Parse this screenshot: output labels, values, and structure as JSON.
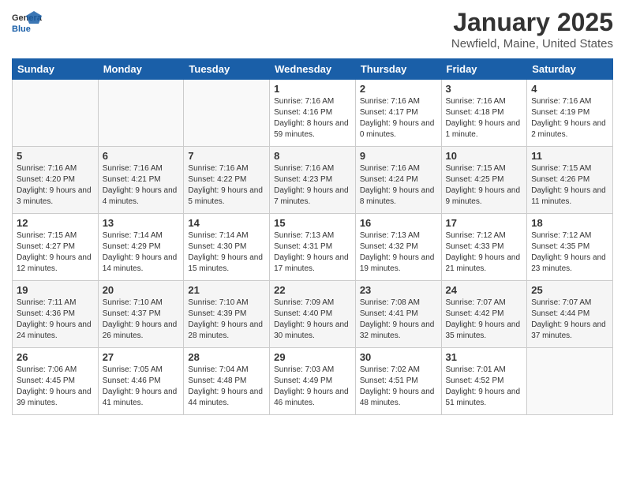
{
  "header": {
    "logo_general": "General",
    "logo_blue": "Blue",
    "month_title": "January 2025",
    "location": "Newfield, Maine, United States"
  },
  "days_of_week": [
    "Sunday",
    "Monday",
    "Tuesday",
    "Wednesday",
    "Thursday",
    "Friday",
    "Saturday"
  ],
  "weeks": [
    [
      {
        "day": "",
        "sunrise": "",
        "sunset": "",
        "daylight": ""
      },
      {
        "day": "",
        "sunrise": "",
        "sunset": "",
        "daylight": ""
      },
      {
        "day": "",
        "sunrise": "",
        "sunset": "",
        "daylight": ""
      },
      {
        "day": "1",
        "sunrise": "Sunrise: 7:16 AM",
        "sunset": "Sunset: 4:16 PM",
        "daylight": "Daylight: 8 hours and 59 minutes."
      },
      {
        "day": "2",
        "sunrise": "Sunrise: 7:16 AM",
        "sunset": "Sunset: 4:17 PM",
        "daylight": "Daylight: 9 hours and 0 minutes."
      },
      {
        "day": "3",
        "sunrise": "Sunrise: 7:16 AM",
        "sunset": "Sunset: 4:18 PM",
        "daylight": "Daylight: 9 hours and 1 minute."
      },
      {
        "day": "4",
        "sunrise": "Sunrise: 7:16 AM",
        "sunset": "Sunset: 4:19 PM",
        "daylight": "Daylight: 9 hours and 2 minutes."
      }
    ],
    [
      {
        "day": "5",
        "sunrise": "Sunrise: 7:16 AM",
        "sunset": "Sunset: 4:20 PM",
        "daylight": "Daylight: 9 hours and 3 minutes."
      },
      {
        "day": "6",
        "sunrise": "Sunrise: 7:16 AM",
        "sunset": "Sunset: 4:21 PM",
        "daylight": "Daylight: 9 hours and 4 minutes."
      },
      {
        "day": "7",
        "sunrise": "Sunrise: 7:16 AM",
        "sunset": "Sunset: 4:22 PM",
        "daylight": "Daylight: 9 hours and 5 minutes."
      },
      {
        "day": "8",
        "sunrise": "Sunrise: 7:16 AM",
        "sunset": "Sunset: 4:23 PM",
        "daylight": "Daylight: 9 hours and 7 minutes."
      },
      {
        "day": "9",
        "sunrise": "Sunrise: 7:16 AM",
        "sunset": "Sunset: 4:24 PM",
        "daylight": "Daylight: 9 hours and 8 minutes."
      },
      {
        "day": "10",
        "sunrise": "Sunrise: 7:15 AM",
        "sunset": "Sunset: 4:25 PM",
        "daylight": "Daylight: 9 hours and 9 minutes."
      },
      {
        "day": "11",
        "sunrise": "Sunrise: 7:15 AM",
        "sunset": "Sunset: 4:26 PM",
        "daylight": "Daylight: 9 hours and 11 minutes."
      }
    ],
    [
      {
        "day": "12",
        "sunrise": "Sunrise: 7:15 AM",
        "sunset": "Sunset: 4:27 PM",
        "daylight": "Daylight: 9 hours and 12 minutes."
      },
      {
        "day": "13",
        "sunrise": "Sunrise: 7:14 AM",
        "sunset": "Sunset: 4:29 PM",
        "daylight": "Daylight: 9 hours and 14 minutes."
      },
      {
        "day": "14",
        "sunrise": "Sunrise: 7:14 AM",
        "sunset": "Sunset: 4:30 PM",
        "daylight": "Daylight: 9 hours and 15 minutes."
      },
      {
        "day": "15",
        "sunrise": "Sunrise: 7:13 AM",
        "sunset": "Sunset: 4:31 PM",
        "daylight": "Daylight: 9 hours and 17 minutes."
      },
      {
        "day": "16",
        "sunrise": "Sunrise: 7:13 AM",
        "sunset": "Sunset: 4:32 PM",
        "daylight": "Daylight: 9 hours and 19 minutes."
      },
      {
        "day": "17",
        "sunrise": "Sunrise: 7:12 AM",
        "sunset": "Sunset: 4:33 PM",
        "daylight": "Daylight: 9 hours and 21 minutes."
      },
      {
        "day": "18",
        "sunrise": "Sunrise: 7:12 AM",
        "sunset": "Sunset: 4:35 PM",
        "daylight": "Daylight: 9 hours and 23 minutes."
      }
    ],
    [
      {
        "day": "19",
        "sunrise": "Sunrise: 7:11 AM",
        "sunset": "Sunset: 4:36 PM",
        "daylight": "Daylight: 9 hours and 24 minutes."
      },
      {
        "day": "20",
        "sunrise": "Sunrise: 7:10 AM",
        "sunset": "Sunset: 4:37 PM",
        "daylight": "Daylight: 9 hours and 26 minutes."
      },
      {
        "day": "21",
        "sunrise": "Sunrise: 7:10 AM",
        "sunset": "Sunset: 4:39 PM",
        "daylight": "Daylight: 9 hours and 28 minutes."
      },
      {
        "day": "22",
        "sunrise": "Sunrise: 7:09 AM",
        "sunset": "Sunset: 4:40 PM",
        "daylight": "Daylight: 9 hours and 30 minutes."
      },
      {
        "day": "23",
        "sunrise": "Sunrise: 7:08 AM",
        "sunset": "Sunset: 4:41 PM",
        "daylight": "Daylight: 9 hours and 32 minutes."
      },
      {
        "day": "24",
        "sunrise": "Sunrise: 7:07 AM",
        "sunset": "Sunset: 4:42 PM",
        "daylight": "Daylight: 9 hours and 35 minutes."
      },
      {
        "day": "25",
        "sunrise": "Sunrise: 7:07 AM",
        "sunset": "Sunset: 4:44 PM",
        "daylight": "Daylight: 9 hours and 37 minutes."
      }
    ],
    [
      {
        "day": "26",
        "sunrise": "Sunrise: 7:06 AM",
        "sunset": "Sunset: 4:45 PM",
        "daylight": "Daylight: 9 hours and 39 minutes."
      },
      {
        "day": "27",
        "sunrise": "Sunrise: 7:05 AM",
        "sunset": "Sunset: 4:46 PM",
        "daylight": "Daylight: 9 hours and 41 minutes."
      },
      {
        "day": "28",
        "sunrise": "Sunrise: 7:04 AM",
        "sunset": "Sunset: 4:48 PM",
        "daylight": "Daylight: 9 hours and 44 minutes."
      },
      {
        "day": "29",
        "sunrise": "Sunrise: 7:03 AM",
        "sunset": "Sunset: 4:49 PM",
        "daylight": "Daylight: 9 hours and 46 minutes."
      },
      {
        "day": "30",
        "sunrise": "Sunrise: 7:02 AM",
        "sunset": "Sunset: 4:51 PM",
        "daylight": "Daylight: 9 hours and 48 minutes."
      },
      {
        "day": "31",
        "sunrise": "Sunrise: 7:01 AM",
        "sunset": "Sunset: 4:52 PM",
        "daylight": "Daylight: 9 hours and 51 minutes."
      },
      {
        "day": "",
        "sunrise": "",
        "sunset": "",
        "daylight": ""
      }
    ]
  ]
}
